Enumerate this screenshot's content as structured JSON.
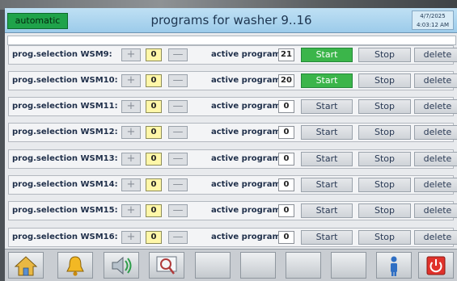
{
  "header": {
    "mode": "automatic",
    "title": "programs for washer 9..16",
    "date": "4/7/2025",
    "time": "4:03:12 AM"
  },
  "labels": {
    "plus": "+",
    "minus": "—",
    "active_program": "active program:",
    "start": "Start",
    "stop": "Stop",
    "delete": "delete"
  },
  "rows": [
    {
      "label": "prog.selection WSM9:",
      "selection": "0",
      "active_program": "21",
      "running": true
    },
    {
      "label": "prog.selection WSM10:",
      "selection": "0",
      "active_program": "20",
      "running": true
    },
    {
      "label": "prog.selection WSM11:",
      "selection": "0",
      "active_program": "0",
      "running": false
    },
    {
      "label": "prog.selection WSM12:",
      "selection": "0",
      "active_program": "0",
      "running": false
    },
    {
      "label": "prog.selection WSM13:",
      "selection": "0",
      "active_program": "0",
      "running": false
    },
    {
      "label": "prog.selection WSM14:",
      "selection": "0",
      "active_program": "0",
      "running": false
    },
    {
      "label": "prog.selection WSM15:",
      "selection": "0",
      "active_program": "0",
      "running": false
    },
    {
      "label": "prog.selection WSM16:",
      "selection": "0",
      "active_program": "0",
      "running": false
    }
  ],
  "toolbar": {
    "icons": [
      "home-icon",
      "alarm-bell-icon",
      "speaker-icon",
      "zoom-icon",
      "operator-icon",
      "power-icon"
    ]
  },
  "colors": {
    "header": "#a9d4ef",
    "mode_badge": "#1fa34a",
    "start_active": "#3bb54a",
    "selection_field": "#fff7a8",
    "power": "#e0322b"
  }
}
